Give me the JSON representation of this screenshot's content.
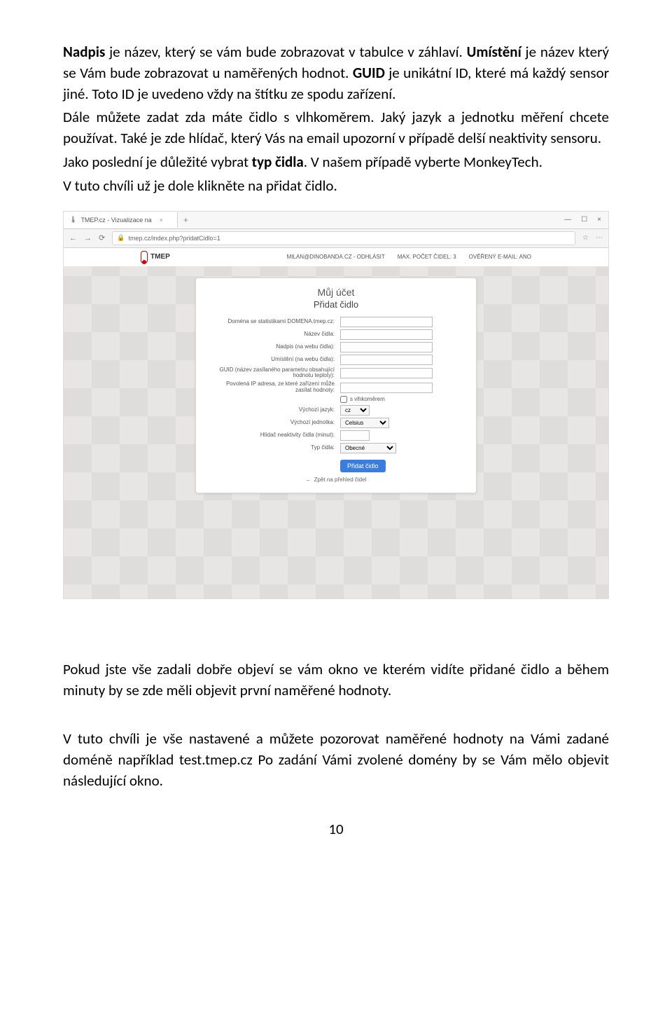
{
  "doc": {
    "p1": [
      {
        "b": "Nadpis",
        "t": " je název, který se vám bude zobrazovat v tabulce v záhlaví."
      },
      {
        "b": "Umístění",
        "t": " je název který se Vám bude zobrazovat u naměřených hodnot."
      },
      {
        "b": "GUID",
        "t": " je unikátní ID, které má každý sensor jiné. Toto ID je uvedeno vždy na štítku ze spodu zařízení."
      }
    ],
    "p2": "Dále můžete zadat zda máte čidlo s vlhkoměrem. Jaký jazyk a jednotku měření chcete používat. Také je zde hlídač, který Vás na email upozorní v případě delší neaktivity sensoru.",
    "p3": {
      "pre": "Jako poslední je důležité vybrat ",
      "b": "typ čidla",
      "post": ". V našem případě vyberte MonkeyTech."
    },
    "p4": "V tuto chvíli už je dole klikněte na přidat čidlo.",
    "p5": "Pokud jste vše zadali dobře objeví se vám okno ve kterém vidíte přidané čidlo a během minuty by se zde měli objevit první naměřené hodnoty.",
    "p6": "V tuto chvíli je vše nastavené a můžete pozorovat naměřené hodnoty na Vámi zadané doméně například test.tmep.cz Po zadání Vámi zvolené domény by se Vám mělo objevit následující okno.",
    "pagenum": "10"
  },
  "shot": {
    "tabTitle": "TMEP.cz - Vizualizace na",
    "url": "tmep.cz/index.php?pridatCidlo=1",
    "logo": "TMEP",
    "topItems": [
      "MILAN@DINOBANDA.CZ - ODHLÁSIT",
      "MAX. POČET ČIDEL: 3",
      "OVĚŘENÝ E-MAIL: ANO"
    ],
    "heading1": "Můj účet",
    "heading2": "Přidat čidlo",
    "fields": {
      "domena": "Doména se statistikami DOMENA.tmep.cz:",
      "nazev": "Název čidla:",
      "nadpis": "Nadpis (na webu čidla):",
      "umisteni": "Umístění (na webu čidla):",
      "guid": "GUID (název zasílaného parametru obsahující hodnotu teploty):",
      "ip": "Povolená IP adresa, ze které zařízení může zasílat hodnoty:",
      "vlhkomer": "s vlhkoměrem",
      "jazyk": "Výchozí jazyk:",
      "jazykVal": "cz",
      "jednotka": "Výchozí jednotka:",
      "jednotkaVal": "Celsius",
      "hlidac": "Hlídač neaktivity čidla (minut):",
      "typ": "Typ čidla:",
      "typVal": "Obecné"
    },
    "submit": "Přidat čidlo",
    "back": "Zpět na přehled čidel"
  }
}
